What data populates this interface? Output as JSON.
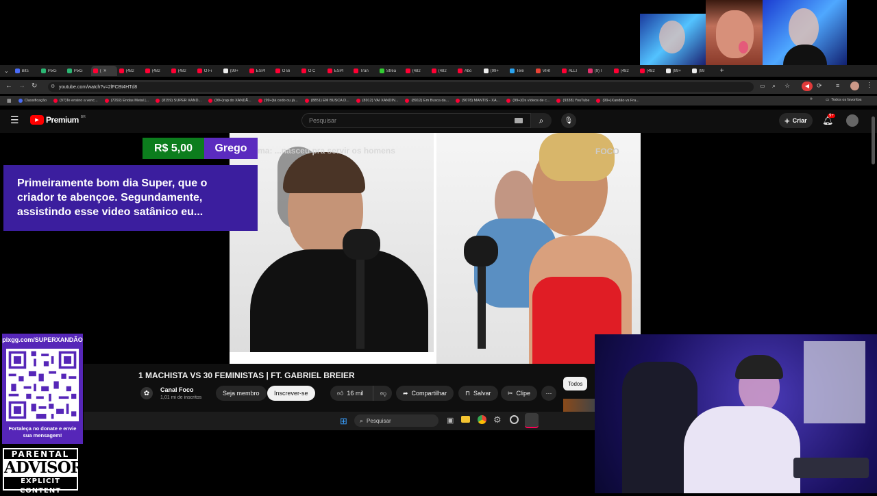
{
  "browser": {
    "tabs": [
      "Bits",
      "PixG",
      "PixG",
      "(",
      "(482",
      "(482",
      "(482",
      "O Fi",
      "(99+",
      "ESPI",
      "O Bi",
      "O C",
      "ESPI",
      "Tran",
      "Strea",
      "(482",
      "(482",
      "Abo",
      "(99+",
      "Tele",
      "VIRI",
      "ALLI",
      "(9) I",
      "(482",
      "(482",
      "(99+",
      "(99"
    ],
    "tab_colors": [
      "#4a6cf7",
      "#2bb673",
      "#2bb673",
      "#f03",
      "#f03",
      "#f03",
      "#f03",
      "#f03",
      "#eee",
      "#f03",
      "#f03",
      "#f03",
      "#f03",
      "#f03",
      "#33cc33",
      "#f03",
      "#f03",
      "#f03",
      "#eee",
      "#2aa3ef",
      "#ea4335",
      "#f03",
      "#e1306c",
      "#f03",
      "#f03",
      "#eee",
      "#eee"
    ],
    "url": "youtube.com/watch?v=2lFCBt4HTd8",
    "bookmarks": [
      "Classificação",
      "(97)Te ensino a venc...",
      "(7292) Endas Metal |...",
      "(8159) SUPER XAND...",
      "(99+)rap do XANDÃ...",
      "(99+)tá cedo ou já...",
      "(8851) EM BUSCA D...",
      "(8912) VAI XANDIN...",
      "(8912) Em Busca da...",
      "(9078) MANTIS - XA...",
      "(99+)Os vídeos de c...",
      "(9338) YouTube",
      "(99+)Xandão vs Fra..."
    ],
    "all_bookmarks": "Todos os favoritos"
  },
  "youtube": {
    "logo": "Premium",
    "logo_badge": "BR",
    "search_placeholder": "Pesquisar",
    "create_label": "Criar",
    "notif_count": "9+",
    "video_overlay_text": "Tema: ...nasceu pra servir os homens",
    "video_title": "1 MACHISTA VS 30 FEMINISTAS | FT. GABRIEL BREIER",
    "channel_name": "Canal Foco",
    "subscribers": "1,01 mi de inscritos",
    "join_label": "Seja membro",
    "subscribe_label": "Inscrever-se",
    "likes": "16 mil",
    "share_label": "Compartilhar",
    "save_label": "Salvar",
    "clip_label": "Clipe",
    "filter_label": "Todos",
    "brand_watermark": "FOCO"
  },
  "taskbar": {
    "search_placeholder": "Pesquisar"
  },
  "donation": {
    "amount": "R$ 5,00",
    "name": "Grego",
    "message": "Primeiramente bom dia Super, que o criador te abençoe. Segundamente, assistindo esse video satânico eu..."
  },
  "pix": {
    "url": "pixgg.com/SUPERXANDÃO",
    "cta": "Fortaleça no donate e envie sua mensagem!"
  },
  "advisory": {
    "line1": "PARENTAL",
    "line2": "ADVISORY",
    "line3": "EXPLICIT CONTENT"
  }
}
